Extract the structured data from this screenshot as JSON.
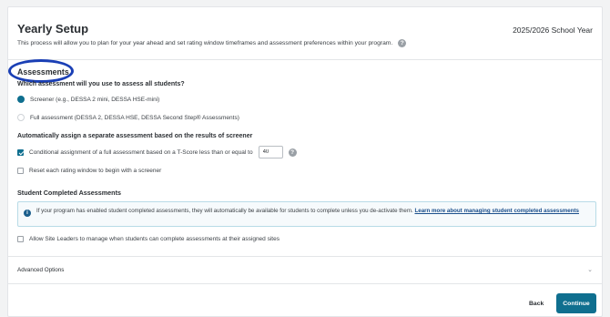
{
  "header": {
    "title": "Yearly Setup",
    "school_year": "2025/2026 School Year",
    "subtitle": "This process will allow you to plan for your year ahead and set rating window timeframes and assessment preferences within your program."
  },
  "assessments": {
    "heading": "Assessments",
    "question": "Which assessment will you use to assess all students?",
    "options": [
      {
        "label": "Screener (e.g., DESSA 2 mini, DESSA HSE-mini)",
        "selected": true
      },
      {
        "label": "Full assessment (DESSA 2, DESSA HSE, DESSA Second Step® Assessments)",
        "selected": false
      }
    ]
  },
  "auto_assign": {
    "heading": "Automatically assign a separate assessment based on the results of screener",
    "conditional_label": "Conditional assignment of a full assessment based on a T-Score less than or equal to",
    "conditional_checked": true,
    "tscore_value": "40",
    "reset_label": "Reset each rating window to begin with a screener",
    "reset_checked": false
  },
  "student_completed": {
    "heading": "Student Completed Assessments",
    "info_text": "If your program has enabled student completed assessments, they will automatically be available for students to complete unless you de-activate them.",
    "info_link": "Learn more about managing student completed assessments",
    "site_leaders_label": "Allow Site Leaders to manage when students can complete assessments at their assigned sites",
    "site_leaders_checked": false
  },
  "advanced": {
    "label": "Advanced Options"
  },
  "footer": {
    "back_label": "Back",
    "continue_label": "Continue"
  },
  "colors": {
    "primary": "#0f6f8f",
    "highlight": "#1a3fb5",
    "info_bg": "#f6fafc"
  }
}
